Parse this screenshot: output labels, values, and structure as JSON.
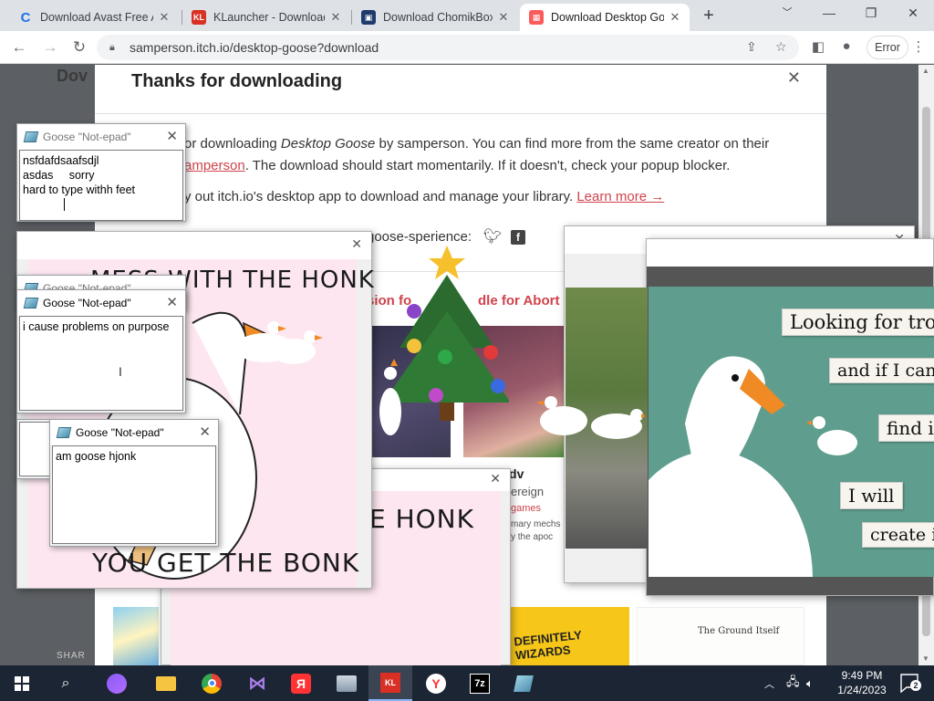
{
  "browser": {
    "tabs": [
      {
        "title": "Download Avast Free A",
        "color": "#1a73e8",
        "glyph": "C"
      },
      {
        "title": "KLauncher - Download",
        "color": "#d93025",
        "glyph": "KL"
      },
      {
        "title": "Download ChomikBox",
        "color": "#1f3b6e",
        "glyph": "▣"
      },
      {
        "title": "Download Desktop Go",
        "color": "#fa5c5c",
        "glyph": "▦"
      }
    ],
    "new_tab": "+",
    "address": "samperson.itch.io/desktop-goose?download",
    "profile_status": "Error"
  },
  "page": {
    "behind_heading": "Dov",
    "modal": {
      "title": "Thanks for downloading",
      "para1_prefix": "or downloading ",
      "para1_game": "Desktop Goose",
      "para1_suffix": " by samperson. You can find more from the same creator on their",
      "para2_link": "amperson",
      "para2_suffix": ". The download should start momentarily. If it doesn't, check your popup blocker.",
      "para3_prefix": "y out itch.io's desktop app to download and manage your library. ",
      "para3_link": "Learn more →",
      "share_label": "goose-sperience:",
      "rec_left": "sion fo",
      "rec_right": "dle for Abort",
      "card_title": "Astir: Adv",
      "card_sub": "ereign",
      "card_genre": "games",
      "card_desc1": "mary mechs",
      "card_desc2": "y the apoc",
      "bottom_card": "The Ground Itself",
      "bottom_card2": "DEFINITELY WIZARDS",
      "share_footer": "SHAR"
    }
  },
  "notepads": [
    {
      "title": "Goose \"Not-epad\"",
      "lines": [
        "nsfdafdsaafsdjl",
        "asdas     sorry",
        "hard to type withh feet"
      ]
    },
    {
      "title": "Goose \"Not-epad\"",
      "lines": [
        ""
      ]
    },
    {
      "title": "Goose \"Not-epad\"",
      "lines": [
        "i cause problems on purpose"
      ]
    },
    {
      "title": "Goose \"Not-epad\"",
      "lines": [
        "am goose hjonk"
      ]
    }
  ],
  "memes": {
    "honk_top": "MESS WITH THE HONK",
    "honk_bottom": "YOU GET THE BONK",
    "honk2": "E HONK",
    "ransom": [
      "Looking for trou",
      "and if I can",
      "find i",
      "I will",
      "create i"
    ]
  },
  "taskbar": {
    "time": "9:49 PM",
    "date": "1/24/2023",
    "notifications": "2"
  }
}
